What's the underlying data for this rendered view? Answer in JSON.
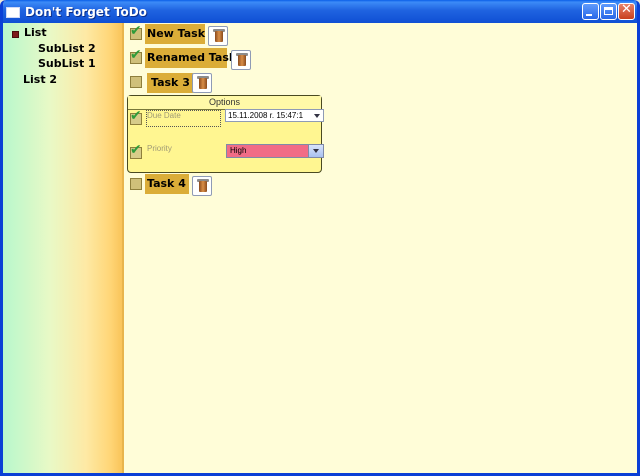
{
  "window": {
    "title": "Don't Forget ToDo",
    "controls": {
      "minimize": "minimize",
      "maximize": "maximize",
      "close": "✕"
    }
  },
  "sidebar": {
    "items": [
      {
        "label": "List",
        "expanded": true,
        "children": [
          {
            "label": "SubList 2"
          },
          {
            "label": "SubList 1"
          }
        ]
      },
      {
        "label": "List 2"
      }
    ]
  },
  "tasks": [
    {
      "label": "New Task",
      "checked": true
    },
    {
      "label": "Renamed Task",
      "checked": true
    },
    {
      "label": "Task 3",
      "checked": false
    },
    {
      "label": "Task 4",
      "checked": false
    }
  ],
  "options": {
    "title": "Options",
    "due_date_label": "Due Date",
    "due_date_value": "15.11.2008 r. 15:47:1",
    "priority_label": "Priority",
    "priority_value": "High"
  },
  "colors": {
    "titlebar": "#0a5ee8",
    "task_label_bg": "#dbad38",
    "main_bg": "#fffdd8",
    "options_bg": "#fff691",
    "priority_high": "#f16c86",
    "checkmark": "#2f9b3a"
  },
  "icons": {
    "delete": "trash-can-icon",
    "check": "checkmark-icon",
    "tree_expander": "tree-expander-icon",
    "dropdown": "chevron-down-icon"
  }
}
